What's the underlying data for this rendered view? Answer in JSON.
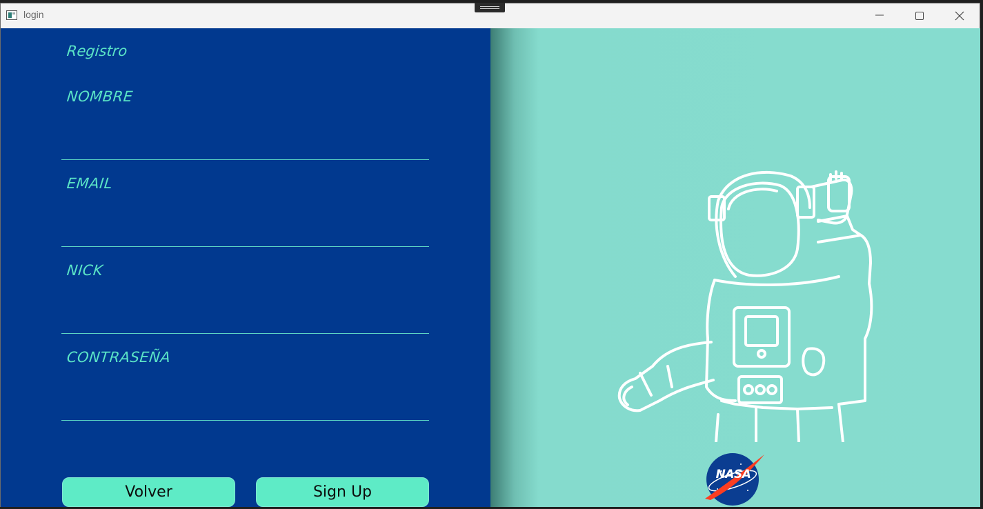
{
  "window": {
    "title": "login"
  },
  "form": {
    "heading": "Registro",
    "fields": [
      {
        "label": "NOMBRE",
        "value": ""
      },
      {
        "label": "EMAIL",
        "value": ""
      },
      {
        "label": "NICK",
        "value": ""
      },
      {
        "label": "CONTRASEÑA",
        "value": ""
      }
    ],
    "back_button": "Volver",
    "signup_button": "Sign Up"
  },
  "logo": {
    "text": "NASA"
  },
  "colors": {
    "left_panel": "#01398f",
    "right_panel": "#86dccf",
    "accent_text": "#5be4c6",
    "button_fill": "#5eebc6"
  },
  "icons": [
    "app-icon",
    "minimize-icon",
    "maximize-icon",
    "close-icon",
    "astronaut-illustration",
    "nasa-logo"
  ]
}
